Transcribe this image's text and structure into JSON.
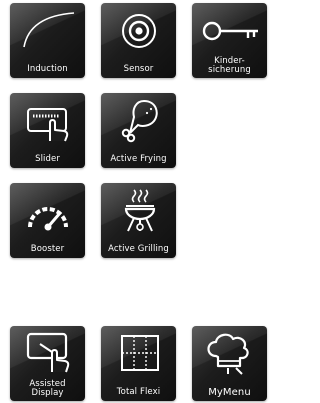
{
  "tiles": [
    {
      "label": "Induction",
      "icon": "induction-icon"
    },
    {
      "label": "Sensor",
      "icon": "sensor-icon"
    },
    {
      "label": "Kinder-\nsicherung",
      "icon": "key-icon"
    },
    {
      "label": "Slider",
      "icon": "slider-touch-icon"
    },
    {
      "label": "Active Frying",
      "icon": "chicken-leg-icon"
    },
    {
      "label": "Booster",
      "icon": "gauge-icon"
    },
    {
      "label": "Active Grilling",
      "icon": "grill-icon"
    },
    {
      "label": "Assisted\nDisplay",
      "icon": "touch-display-icon"
    },
    {
      "label": "Total Flexi",
      "icon": "flexi-zone-icon"
    },
    {
      "label": "MyMenu",
      "icon": "chef-hat-icon"
    }
  ],
  "colors": {
    "tile_bg": "#1c1c1c",
    "text": "#ffffff",
    "page_bg": "#ffffff"
  }
}
